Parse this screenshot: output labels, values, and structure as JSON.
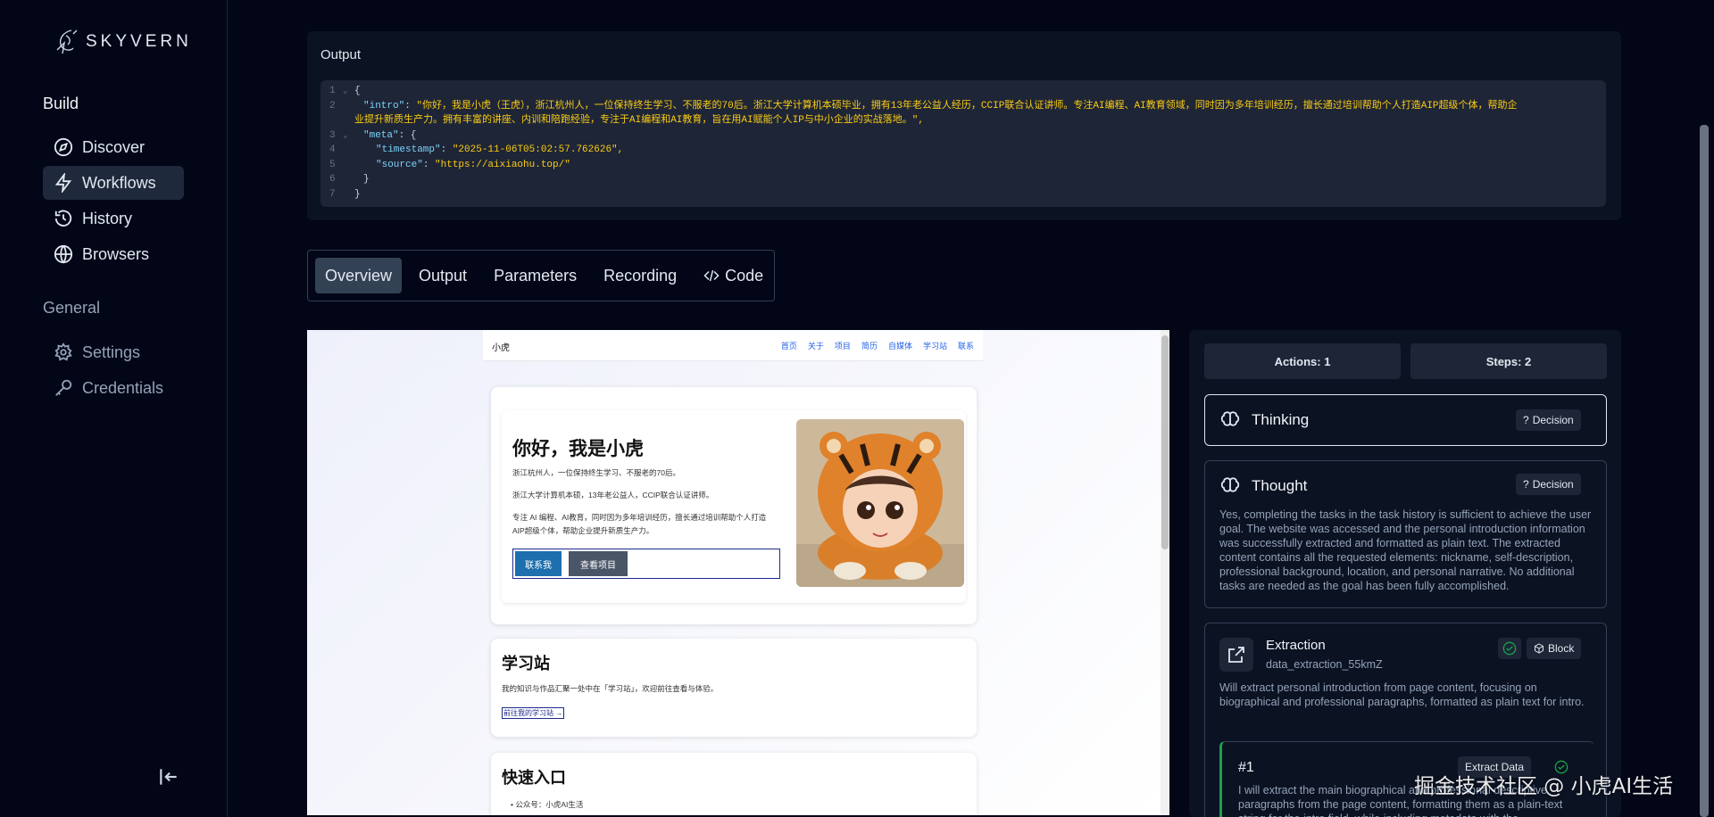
{
  "app": {
    "logo_text": "SKYVERN"
  },
  "sidebar": {
    "build_title": "Build",
    "general_title": "General",
    "items": [
      {
        "label": "Discover",
        "icon": "compass-icon"
      },
      {
        "label": "Workflows",
        "icon": "lightning-icon",
        "active": true
      },
      {
        "label": "History",
        "icon": "history-icon"
      },
      {
        "label": "Browsers",
        "icon": "globe-icon"
      }
    ],
    "general_items": [
      {
        "label": "Settings",
        "icon": "gear-icon"
      },
      {
        "label": "Credentials",
        "icon": "key-icon"
      }
    ]
  },
  "output": {
    "label": "Output",
    "lines": [
      {
        "n": "1",
        "text": "{"
      },
      {
        "n": "2",
        "key": "\"intro\"",
        "value": "\"你好，我是小虎（王虎），浙江杭州人，一位保持终生学习、不服老的70后。浙江大学计算机本硕毕业，拥有13年老公益人经历，CCIP联合认证讲师。专注AI编程、AI教育领域，同时因为多年培训经历，擅长通过培训帮助个人打造AIP超级个体，帮助企",
        "cont": "业提升新质生产力。拥有丰富的讲座、内训和陪跑经验，专注于AI编程和AI教育，旨在用AI赋能个人IP与中小企业的实战落地。\","
      },
      {
        "n": "3",
        "key": "\"meta\"",
        "text": ": {"
      },
      {
        "n": "4",
        "key": "\"timestamp\"",
        "value": "\"2025-11-06T05:02:57.762626\","
      },
      {
        "n": "5",
        "key": "\"source\"",
        "value": "\"https://aixiaohu.top/\""
      },
      {
        "n": "6",
        "text": "}"
      },
      {
        "n": "7",
        "text": "}"
      }
    ]
  },
  "tabs": [
    {
      "label": "Overview",
      "active": true
    },
    {
      "label": "Output"
    },
    {
      "label": "Parameters"
    },
    {
      "label": "Recording"
    },
    {
      "label": "Code",
      "icon": "code-icon"
    }
  ],
  "preview": {
    "site_brand": "小虎",
    "nav_links": [
      "首页",
      "关于",
      "项目",
      "简历",
      "自媒体",
      "学习站",
      "联系"
    ],
    "hero_title": "你好，我是小虎",
    "hero_lines": [
      "浙江杭州人，一位保持终生学习、不服老的70后。",
      "浙江大学计算机本硕，13年老公益人，CCIP联合认证讲师。",
      "专注 AI 编程、AI教育，同时因为多年培训经历，擅长通过培训帮助个人打造",
      "AIP超级个体，帮助企业提升新质生产力。"
    ],
    "btn_contact": "联系我",
    "btn_projects": "查看项目",
    "study_title": "学习站",
    "study_text": "我的知识与作品汇聚一处中在「学习站」，欢迎前往查看与体验。",
    "study_link": "前往我的学习站 →",
    "quick_title": "快速入口",
    "quick_item": "• 公众号：小虎AI生活"
  },
  "panel": {
    "actions": "Actions: 1",
    "steps": "Steps: 2",
    "thinking_title": "Thinking",
    "decision_label": "Decision",
    "thought_title": "Thought",
    "thought_text": "Yes, completing the tasks in the task history is sufficient to achieve the user goal. The website was accessed and the personal introduction information was successfully extracted and formatted as plain text. The extracted content contains all the requested elements: nickname, self-description, professional background, location, and personal narrative. No additional tasks are needed as the goal has been fully accomplished.",
    "extraction_title": "Extraction",
    "extraction_id": "data_extraction_55kmZ",
    "block_label": "Block",
    "extraction_text": "Will extract personal introduction from page content, focusing on biographical and professional paragraphs, formatted as plain text for intro.",
    "step_number": "#1",
    "step_badge": "Extract Data",
    "step_text": "I will extract the main biographical and professional descriptive paragraphs from the page content, formatting them as a plain-text string for the intro field, while including metadata with the"
  },
  "watermark": "掘金技术社区 @ 小虎AI生活",
  "colors": {
    "accent": "#1e293b",
    "success": "#16a34a",
    "code_key": "#7dd3fc",
    "code_string": "#facc15"
  }
}
